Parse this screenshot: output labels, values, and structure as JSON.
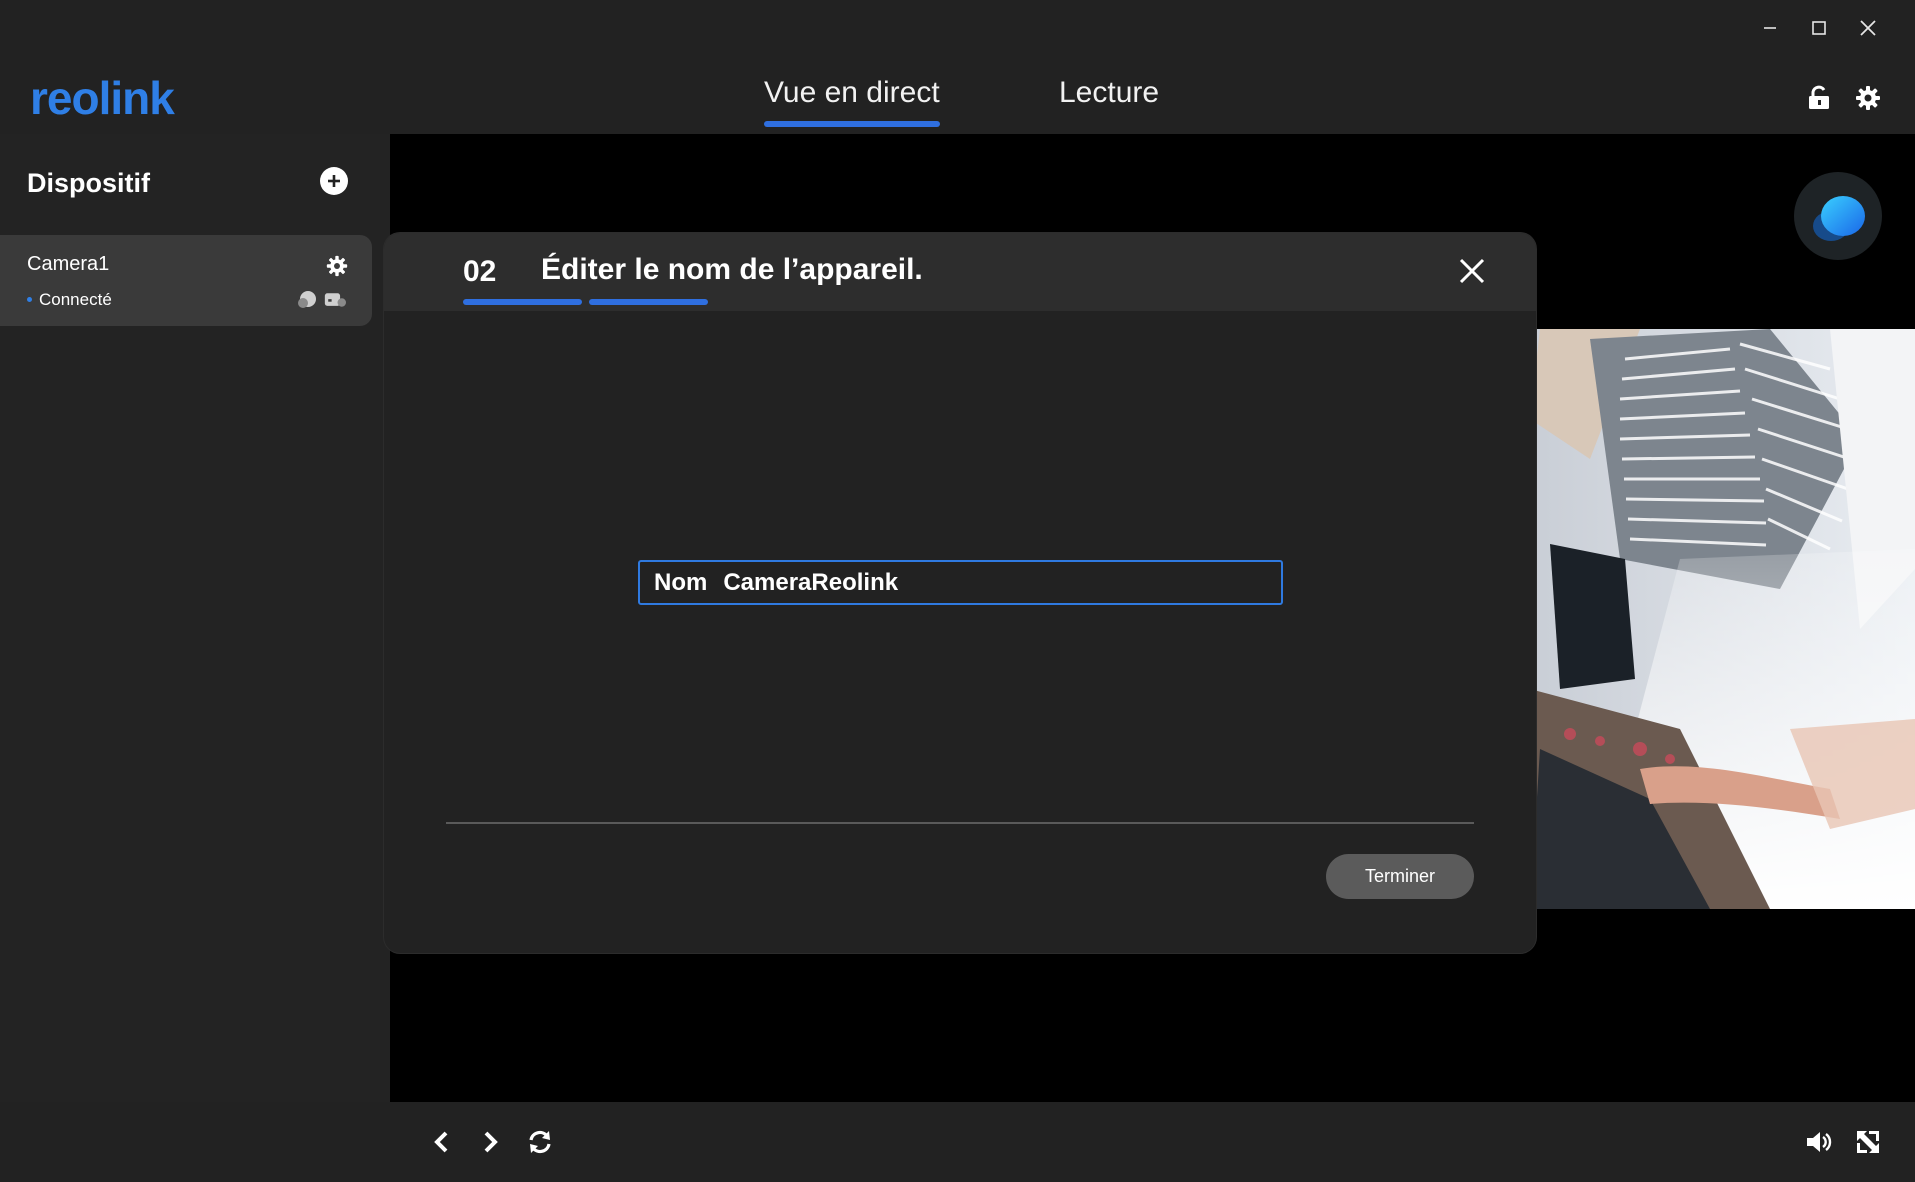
{
  "app": {
    "brand": "reolink",
    "colors": {
      "accent": "#2f6fe0",
      "background": "#222222",
      "card": "#3a3a3a",
      "button": "#5b5b5b"
    }
  },
  "window_controls": {
    "icons": [
      "minimize-icon",
      "maximize-icon",
      "close-icon"
    ]
  },
  "nav": {
    "tabs": [
      {
        "label": "Vue en direct",
        "active": true
      },
      {
        "label": "Lecture",
        "active": false
      }
    ],
    "right_icons": [
      "unlock-icon",
      "gear-icon"
    ]
  },
  "sidebar": {
    "title": "Dispositif",
    "devices": [
      {
        "name": "Camera1",
        "status": "Connecté"
      }
    ]
  },
  "modal": {
    "step_number": "02",
    "step_title": "Éditer le nom de l’appareil.",
    "progress_steps_done": 2,
    "field_label": "Nom",
    "field_value": "CameraReolink",
    "finish_label": "Terminer"
  },
  "bottombar": {
    "left_icons": [
      "prev-icon",
      "next-icon",
      "refresh-icon"
    ],
    "right_icons": [
      "volume-icon",
      "fullscreen-icon"
    ]
  }
}
